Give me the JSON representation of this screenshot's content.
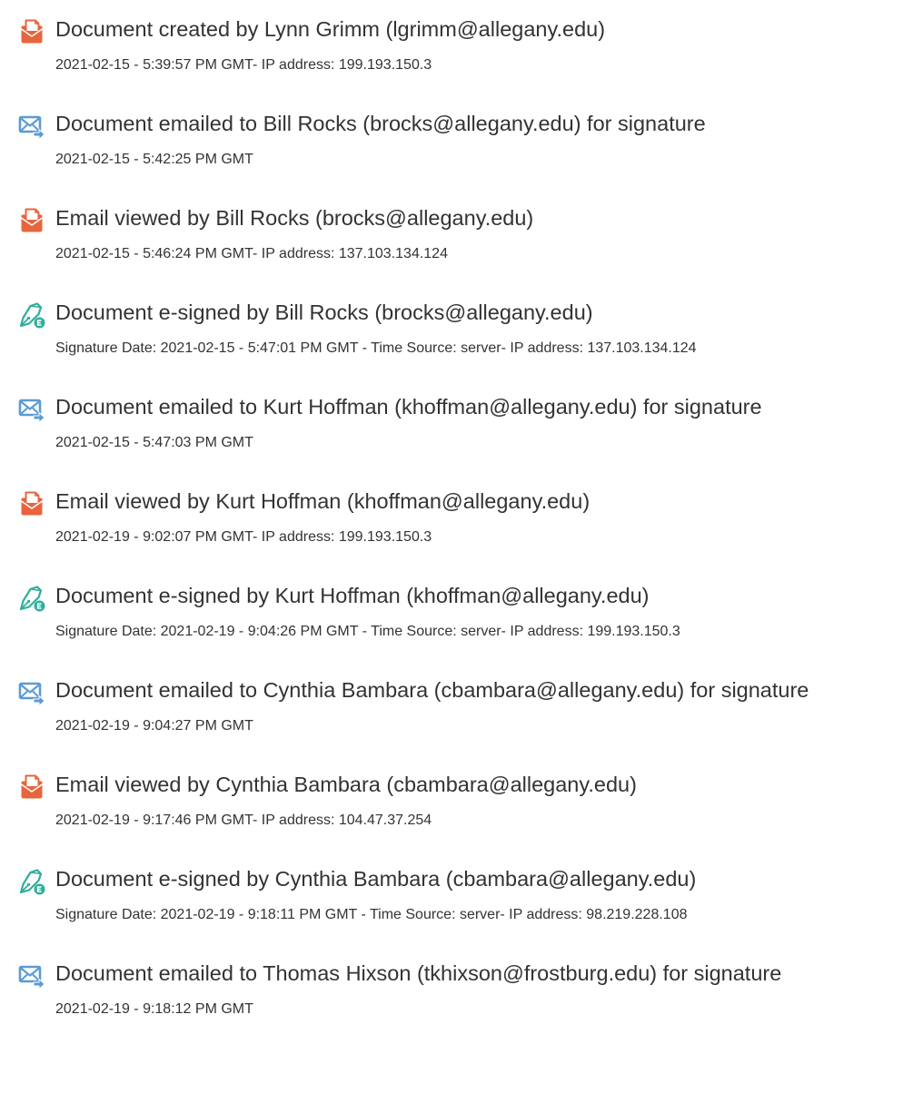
{
  "events": [
    {
      "icon": "document-icon",
      "title": "Document created by Lynn Grimm (lgrimm@allegany.edu)",
      "detail": "2021-02-15 - 5:39:57 PM GMT- IP address: 199.193.150.3"
    },
    {
      "icon": "email-sent-icon",
      "title": "Document emailed to Bill Rocks (brocks@allegany.edu) for signature",
      "detail": "2021-02-15 - 5:42:25 PM GMT"
    },
    {
      "icon": "document-icon",
      "title": "Email viewed by Bill Rocks (brocks@allegany.edu)",
      "detail": "2021-02-15 - 5:46:24 PM GMT- IP address: 137.103.134.124"
    },
    {
      "icon": "esign-pen-icon",
      "title": "Document e-signed by Bill Rocks (brocks@allegany.edu)",
      "detail": "Signature Date: 2021-02-15 - 5:47:01 PM GMT - Time Source: server- IP address: 137.103.134.124"
    },
    {
      "icon": "email-sent-icon",
      "title": "Document emailed to Kurt Hoffman (khoffman@allegany.edu) for signature",
      "detail": "2021-02-15 - 5:47:03 PM GMT"
    },
    {
      "icon": "document-icon",
      "title": "Email viewed by Kurt Hoffman (khoffman@allegany.edu)",
      "detail": "2021-02-19 - 9:02:07 PM GMT- IP address: 199.193.150.3"
    },
    {
      "icon": "esign-pen-icon",
      "title": "Document e-signed by Kurt Hoffman (khoffman@allegany.edu)",
      "detail": "Signature Date: 2021-02-19 - 9:04:26 PM GMT - Time Source: server- IP address: 199.193.150.3"
    },
    {
      "icon": "email-sent-icon",
      "title": "Document emailed to Cynthia Bambara (cbambara@allegany.edu) for signature",
      "detail": "2021-02-19 - 9:04:27 PM GMT"
    },
    {
      "icon": "document-icon",
      "title": "Email viewed by Cynthia Bambara (cbambara@allegany.edu)",
      "detail": "2021-02-19 - 9:17:46 PM GMT- IP address: 104.47.37.254"
    },
    {
      "icon": "esign-pen-icon",
      "title": "Document e-signed by Cynthia Bambara (cbambara@allegany.edu)",
      "detail": "Signature Date: 2021-02-19 - 9:18:11 PM GMT - Time Source: server- IP address: 98.219.228.108"
    },
    {
      "icon": "email-sent-icon",
      "title": "Document emailed to Thomas Hixson (tkhixson@frostburg.edu) for signature",
      "detail": "2021-02-19 - 9:18:12 PM GMT"
    }
  ],
  "colors": {
    "document_icon": "#e8643c",
    "email_icon": "#5b9bd5",
    "esign_icon": "#2eaf9a",
    "text": "#333333"
  }
}
